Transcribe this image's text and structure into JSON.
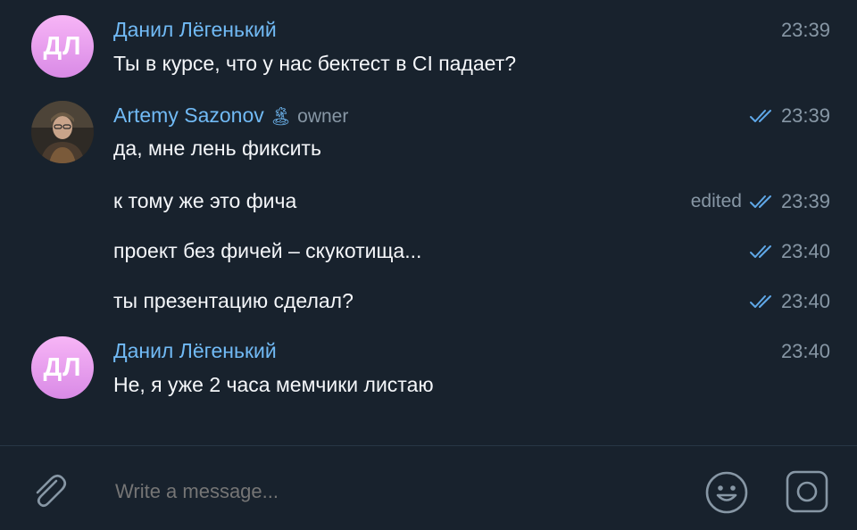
{
  "messages": [
    {
      "sender": "Данил Лёгенький",
      "avatar_initials": "ДЛ",
      "text": "Ты в курсе, что у нас бектест в CI падает?",
      "time": "23:39"
    },
    {
      "sender": "Artemy Sazonov",
      "sender_emoji": "🏝",
      "sender_role": "owner",
      "text": "да, мне лень фиксить",
      "time": "23:39"
    },
    {
      "text": "к тому же это фича",
      "edited_label": "edited",
      "time": "23:39"
    },
    {
      "text": "проект без фичей – скукотища...",
      "time": "23:40"
    },
    {
      "text": "ты презентацию сделал?",
      "time": "23:40"
    },
    {
      "sender": "Данил Лёгенький",
      "avatar_initials": "ДЛ",
      "text": "Не, я уже 2 часа мемчики листаю",
      "time": "23:40"
    }
  ],
  "composer": {
    "placeholder": "Write a message..."
  },
  "icons": {
    "attach": "paperclip-icon",
    "emoji": "smiley-icon",
    "camera": "camera-icon",
    "read_ticks": "double-check-icon"
  },
  "colors": {
    "background": "#18222d",
    "sender_name": "#71baf5",
    "read_ticks": "#5fa8e8",
    "meta_text": "#8797a5",
    "avatar_gradient_top": "#f7b5f6",
    "avatar_gradient_bottom": "#d98ae6"
  }
}
